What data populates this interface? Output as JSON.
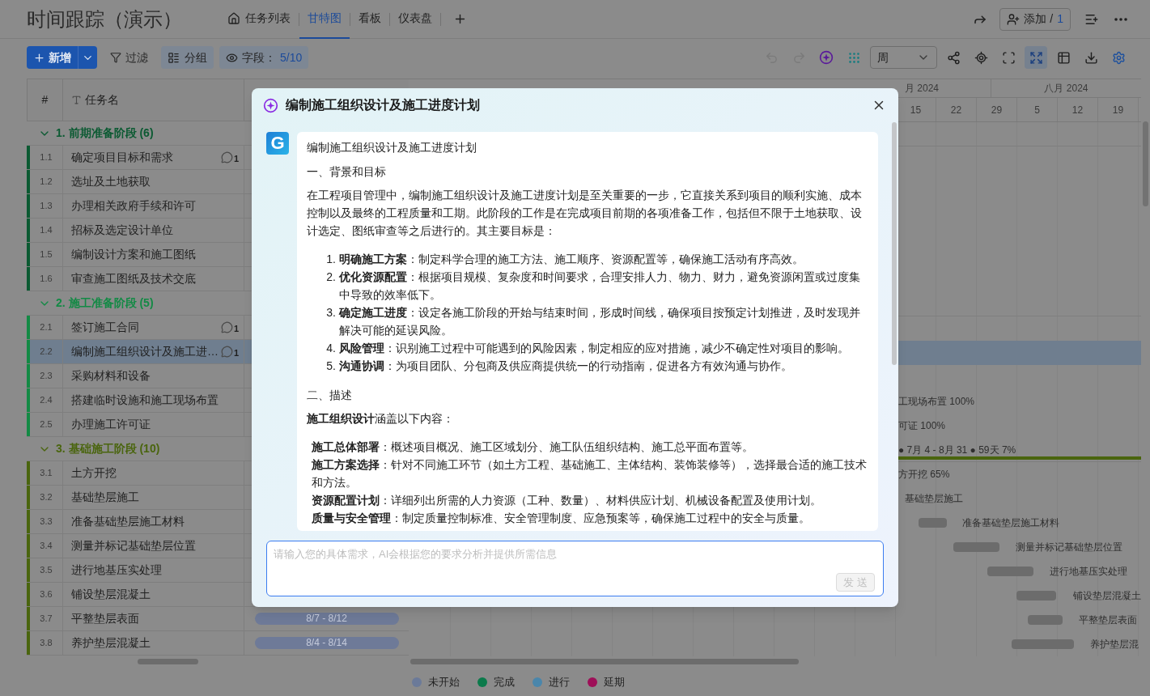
{
  "header": {
    "title": "时间跟踪（演示）",
    "tabs": [
      {
        "label": "任务列表",
        "kind": "home",
        "selected": false
      },
      {
        "label": "甘特图",
        "kind": "plain",
        "selected": true
      },
      {
        "label": "看板",
        "kind": "plain",
        "selected": false
      },
      {
        "label": "仪表盘",
        "kind": "plain",
        "selected": false
      }
    ],
    "add_member": {
      "label": "添加 /",
      "count": "1"
    }
  },
  "toolbar": {
    "new_button": "新增",
    "filter": "过滤",
    "group": "分组",
    "fields": {
      "label": "字段：",
      "value": "5/10"
    },
    "view_select": "周",
    "tools": [
      {
        "kind": "undo",
        "selected": false
      },
      {
        "kind": "redo",
        "selected": false
      },
      {
        "kind": "ai",
        "selected": false
      },
      {
        "kind": "grid",
        "selected": false
      },
      {
        "kind": "select"
      },
      {
        "kind": "share",
        "selected": false
      },
      {
        "kind": "locate",
        "selected": false
      },
      {
        "kind": "scan",
        "selected": false
      },
      {
        "kind": "expand",
        "selected": true
      },
      {
        "kind": "table",
        "selected": false
      },
      {
        "kind": "download",
        "selected": false
      },
      {
        "kind": "settings",
        "selected": false
      }
    ]
  },
  "table": {
    "columns": [
      "#",
      "任务名"
    ],
    "groups": [
      {
        "label": "1. 前期准备阶段 (6)",
        "color": "#0b5a32",
        "expanded": true,
        "tasks": [
          {
            "id": "1.1",
            "name": "确定项目目标和需求",
            "comments": "1",
            "selected": false
          },
          {
            "id": "1.2",
            "name": "选址及土地获取",
            "selected": false
          },
          {
            "id": "1.3",
            "name": "办理相关政府手续和许可",
            "selected": false
          },
          {
            "id": "1.4",
            "name": "招标及选定设计单位",
            "selected": false
          },
          {
            "id": "1.5",
            "name": "编制设计方案和施工图纸",
            "selected": false
          },
          {
            "id": "1.6",
            "name": "审查施工图纸及技术交底",
            "selected": false
          }
        ]
      },
      {
        "label": "2. 施工准备阶段 (5)",
        "color": "#138a45",
        "expanded": true,
        "tasks": [
          {
            "id": "2.1",
            "name": "签订施工合同",
            "comments": "1",
            "selected": false
          },
          {
            "id": "2.2",
            "name": "编制施工组织设计及施工进…",
            "comments": "1",
            "selected": true
          },
          {
            "id": "2.3",
            "name": "采购材料和设备",
            "selected": false
          },
          {
            "id": "2.4",
            "name": "搭建临时设施和施工现场布置",
            "selected": false,
            "gantt": {
              "label": "工现场布置 100%",
              "bar": false
            }
          },
          {
            "id": "2.5",
            "name": "办理施工许可证",
            "selected": false,
            "gantt": {
              "label": "可证 100%",
              "bar": false
            }
          }
        ]
      },
      {
        "label": "3. 基础施工阶段 (10)",
        "color": "#4a650e",
        "expanded": true,
        "gantt": {
          "label": "● 7月 4 - 8月 31 ● 59天 7%",
          "bar": true
        },
        "tasks": [
          {
            "id": "3.1",
            "name": "土方开挖",
            "selected": false,
            "gantt": {
              "label": "方开挖 65%",
              "bar": false
            }
          },
          {
            "id": "3.2",
            "name": "基础垫层施工",
            "selected": false,
            "gantt": {
              "label": "基础垫层施工",
              "bar": false
            }
          },
          {
            "id": "3.3",
            "name": "准备基础垫层施工材料",
            "selected": false,
            "gantt": {
              "label": "准备基础垫层施工材料",
              "bar": true
            }
          },
          {
            "id": "3.4",
            "name": "测量并标记基础垫层位置",
            "selected": false,
            "gantt": {
              "label": "测量并标记基础垫层位置",
              "bar": true
            }
          },
          {
            "id": "3.5",
            "name": "进行地基压实处理",
            "selected": false,
            "gantt": {
              "label": "进行地基压实处理",
              "bar": true
            }
          },
          {
            "id": "3.6",
            "name": "铺设垫层混凝土",
            "selected": false,
            "gantt": {
              "label": "铺设垫层混凝土",
              "bar": true
            }
          },
          {
            "id": "3.7",
            "name": "平整垫层表面",
            "selected": false,
            "dates": "8/7 - 8/12",
            "gantt": {
              "label": "平整垫层表面",
              "bar": true
            }
          },
          {
            "id": "3.8",
            "name": "养护垫层混凝土",
            "selected": false,
            "dates": "8/4 - 8/14",
            "gantt": {
              "label": "养护垫层混",
              "bar": true
            }
          }
        ]
      }
    ]
  },
  "timeline": {
    "months": [
      "月 2024",
      "八月 2024"
    ],
    "weeks": [
      "15",
      "22",
      "29",
      "5",
      "12",
      "19"
    ]
  },
  "legend": [
    {
      "label": "未开始",
      "color": "#6b7a99"
    },
    {
      "label": "完成",
      "color": "#0b7a4b"
    },
    {
      "label": "进行",
      "color": "#4a86ab"
    },
    {
      "label": "延期",
      "color": "#9e0f58"
    }
  ],
  "dialog": {
    "title": "编制施工组织设计及施工进度计划",
    "logo": "G",
    "content": [
      {
        "kind": "para",
        "text": "编制施工组织设计及施工进度计划"
      },
      {
        "kind": "para",
        "text": "一、背景和目标"
      },
      {
        "kind": "para",
        "text": "在工程项目管理中，编制施工组织设计及施工进度计划是至关重要的一步，它直接关系到项目的顺利实施、成本控制以及最终的工程质量和工期。此阶段的工作是在完成项目前期的各项准备工作，包括但不限于土地获取、设计选定、图纸审查等之后进行的。其主要目标是："
      },
      {
        "kind": "ordered",
        "items": [
          {
            "num": "1.",
            "text": "**明确施工方案**：制定科学合理的施工方法、施工顺序、资源配置等，确保施工活动有序高效。"
          },
          {
            "num": "2.",
            "text": "**优化资源配置**：根据项目规模、复杂度和时间要求，合理安排人力、物力、财力，避免资源闲置或过度集中导致的效率低下。"
          },
          {
            "num": "3.",
            "text": "**确定施工进度**：设定各施工阶段的开始与结束时间，形成时间线，确保项目按预定计划推进，及时发现并解决可能的延误风险。"
          },
          {
            "num": "4.",
            "text": "**风险管理**：识别施工过程中可能遇到的风险因素，制定相应的应对措施，减少不确定性对项目的影响。"
          },
          {
            "num": "5.",
            "text": "**沟通协调**：为项目团队、分包商及供应商提供统一的行动指南，促进各方有效沟通与协作。"
          }
        ]
      },
      {
        "kind": "para",
        "text": "二、描述"
      },
      {
        "kind": "para",
        "text": "**施工组织设计**涵盖以下内容："
      },
      {
        "kind": "plain",
        "items": [
          "**施工总体部署**：概述项目概况、施工区域划分、施工队伍组织结构、施工总平面布置等。",
          "**施工方案选择**：针对不同施工环节（如土方工程、基础施工、主体结构、装饰装修等），选择最合适的施工技术和方法。",
          "**资源配置计划**：详细列出所需的人力资源（工种、数量）、材料供应计划、机械设备配置及使用计划。",
          "**质量与安全管理**：制定质量控制标准、安全管理制度、应急预案等，确保施工过程中的安全与质量。"
        ]
      }
    ],
    "input": {
      "placeholder": "请输入您的具体需求，AI会根据您的要求分析并提供所需信息"
    },
    "send_button": {
      "label": "发 送",
      "disabled": true
    }
  }
}
